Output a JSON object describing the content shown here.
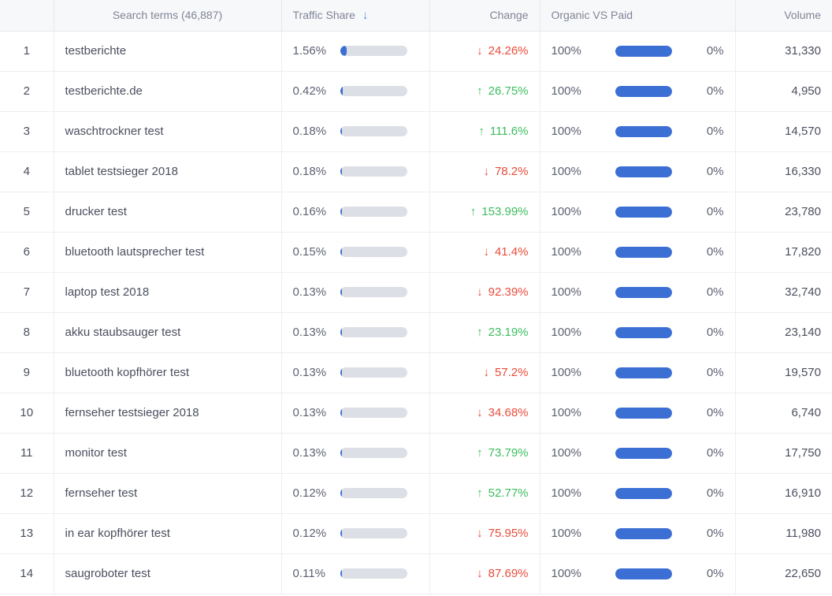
{
  "table": {
    "columns": [
      {
        "key": "rank",
        "label": "",
        "align": "center"
      },
      {
        "key": "term",
        "label": "Search terms (46,887)",
        "align": "center"
      },
      {
        "key": "share",
        "label": "Traffic Share",
        "align": "left",
        "sort_icon": "arrow-down-icon",
        "sort_glyph": "↓"
      },
      {
        "key": "change",
        "label": "Change",
        "align": "right"
      },
      {
        "key": "ovp",
        "label": "Organic VS Paid",
        "align": "left"
      },
      {
        "key": "volume",
        "label": "Volume",
        "align": "right"
      }
    ],
    "rows": [
      {
        "rank": "1",
        "term": "testberichte",
        "share": "1.56%",
        "share_pct": 1.56,
        "change": "24.26%",
        "change_dir": "down",
        "change_glyph": "↓",
        "organic": "100%",
        "paid": "0%",
        "organic_pct": 100,
        "volume": "31,330"
      },
      {
        "rank": "2",
        "term": "testberichte.de",
        "share": "0.42%",
        "share_pct": 0.42,
        "change": "26.75%",
        "change_dir": "up",
        "change_glyph": "↑",
        "organic": "100%",
        "paid": "0%",
        "organic_pct": 100,
        "volume": "4,950"
      },
      {
        "rank": "3",
        "term": "waschtrockner test",
        "share": "0.18%",
        "share_pct": 0.18,
        "change": "111.6%",
        "change_dir": "up",
        "change_glyph": "↑",
        "organic": "100%",
        "paid": "0%",
        "organic_pct": 100,
        "volume": "14,570"
      },
      {
        "rank": "4",
        "term": "tablet testsieger 2018",
        "share": "0.18%",
        "share_pct": 0.18,
        "change": "78.2%",
        "change_dir": "down",
        "change_glyph": "↓",
        "organic": "100%",
        "paid": "0%",
        "organic_pct": 100,
        "volume": "16,330"
      },
      {
        "rank": "5",
        "term": "drucker test",
        "share": "0.16%",
        "share_pct": 0.16,
        "change": "153.99%",
        "change_dir": "up",
        "change_glyph": "↑",
        "organic": "100%",
        "paid": "0%",
        "organic_pct": 100,
        "volume": "23,780"
      },
      {
        "rank": "6",
        "term": "bluetooth lautsprecher test",
        "share": "0.15%",
        "share_pct": 0.15,
        "change": "41.4%",
        "change_dir": "down",
        "change_glyph": "↓",
        "organic": "100%",
        "paid": "0%",
        "organic_pct": 100,
        "volume": "17,820"
      },
      {
        "rank": "7",
        "term": "laptop test 2018",
        "share": "0.13%",
        "share_pct": 0.13,
        "change": "92.39%",
        "change_dir": "down",
        "change_glyph": "↓",
        "organic": "100%",
        "paid": "0%",
        "organic_pct": 100,
        "volume": "32,740"
      },
      {
        "rank": "8",
        "term": "akku staubsauger test",
        "share": "0.13%",
        "share_pct": 0.13,
        "change": "23.19%",
        "change_dir": "up",
        "change_glyph": "↑",
        "organic": "100%",
        "paid": "0%",
        "organic_pct": 100,
        "volume": "23,140"
      },
      {
        "rank": "9",
        "term": "bluetooth kopfhörer test",
        "share": "0.13%",
        "share_pct": 0.13,
        "change": "57.2%",
        "change_dir": "down",
        "change_glyph": "↓",
        "organic": "100%",
        "paid": "0%",
        "organic_pct": 100,
        "volume": "19,570"
      },
      {
        "rank": "10",
        "term": "fernseher testsieger 2018",
        "share": "0.13%",
        "share_pct": 0.13,
        "change": "34.68%",
        "change_dir": "down",
        "change_glyph": "↓",
        "organic": "100%",
        "paid": "0%",
        "organic_pct": 100,
        "volume": "6,740"
      },
      {
        "rank": "11",
        "term": "monitor test",
        "share": "0.13%",
        "share_pct": 0.13,
        "change": "73.79%",
        "change_dir": "up",
        "change_glyph": "↑",
        "organic": "100%",
        "paid": "0%",
        "organic_pct": 100,
        "volume": "17,750"
      },
      {
        "rank": "12",
        "term": "fernseher test",
        "share": "0.12%",
        "share_pct": 0.12,
        "change": "52.77%",
        "change_dir": "up",
        "change_glyph": "↑",
        "organic": "100%",
        "paid": "0%",
        "organic_pct": 100,
        "volume": "16,910"
      },
      {
        "rank": "13",
        "term": "in ear kopfhörer test",
        "share": "0.12%",
        "share_pct": 0.12,
        "change": "75.95%",
        "change_dir": "down",
        "change_glyph": "↓",
        "organic": "100%",
        "paid": "0%",
        "organic_pct": 100,
        "volume": "11,980"
      },
      {
        "rank": "14",
        "term": "saugroboter test",
        "share": "0.11%",
        "share_pct": 0.11,
        "change": "87.69%",
        "change_dir": "down",
        "change_glyph": "↓",
        "organic": "100%",
        "paid": "0%",
        "organic_pct": 100,
        "volume": "22,650"
      }
    ]
  },
  "colors": {
    "accent": "#3b6fd4",
    "sort_arrow": "#5b8def",
    "increase": "#3dbd5e",
    "decrease": "#ea4c3b",
    "header_bg": "#f7f8f9",
    "header_text": "#7f8599",
    "bar_track": "#dcdfe6"
  }
}
